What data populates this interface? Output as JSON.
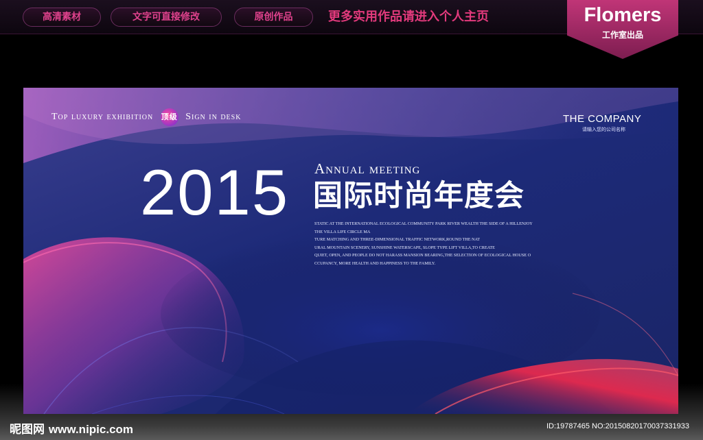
{
  "topbar": {
    "pills": [
      "高清素材",
      "文字可直接修改",
      "原创作品"
    ],
    "promo": "更多实用作品请进入个人主页",
    "brand_name": "Flomers",
    "brand_sub": "工作室出品"
  },
  "banner": {
    "tagline_left": "Top luxury exhibition",
    "badge": "顶级",
    "tagline_right": "Sign in desk",
    "company": "THE COMPANY",
    "company_sub": "请输入您的公司名称",
    "year": "2015",
    "annual": "Annual meeting",
    "title": "国际时尚年度会",
    "description": [
      "STATIC AT THE INTERNATIONAL ECOLOGICAL COMMUNITY PARK RIVER WEALTH THE SIDE OF A HILLENJOY",
      "THE VILLA LIFE CIRCLE MA",
      "TURE MATCHING AND THREE-DIMENSIONAL TRAFFIC NETWORK,ROUND THE NAT",
      "URAL MOUNTAIN SCENERY, SUNSHINE WATERSCAPE, SLOPE TYPE LIFT VILLA,TO CREATE",
      "QUIET, OPEN, AND PEOPLE DO NOT HARASS MANSION BEARING,THE SELECTION OF ECOLOGICAL HOUSE O",
      "CCUPANCY, MORE HEALTH AND HAPPINESS TO THE FAMILY."
    ]
  },
  "watermark": {
    "site_cn": "昵图网",
    "site_url": "www.nipic.com",
    "id_text": "ID:19787465 NO:20150820170037331933"
  },
  "colors": {
    "accent_pink": "#e23a7c",
    "brand_magenta": "#b0306f",
    "banner_blue": "#1d2a78"
  }
}
